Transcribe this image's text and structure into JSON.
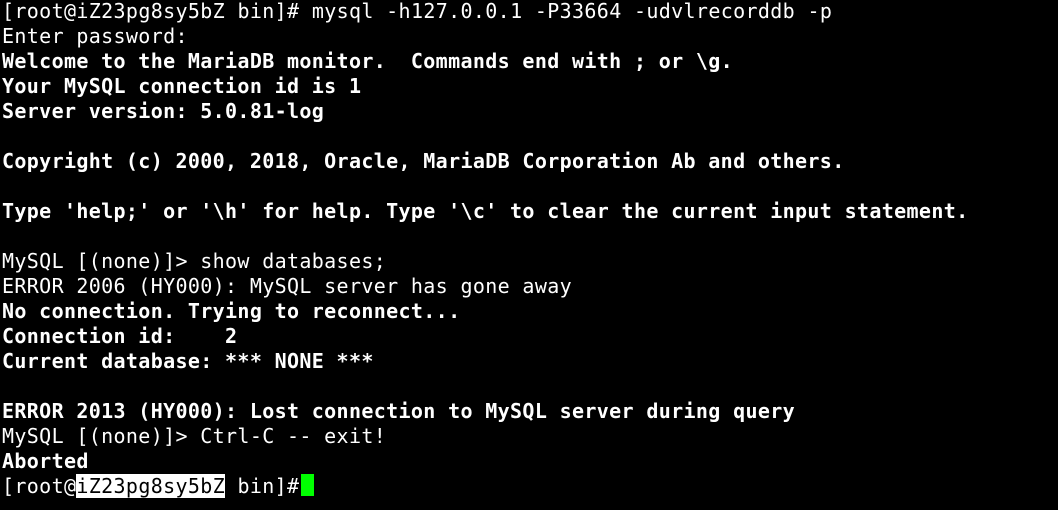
{
  "terminal": {
    "prompt_user_host_prefix": "[root@",
    "prompt_host": "iZ23pg8sy5bZ",
    "prompt_suffix": " bin]#",
    "command_1": " mysql -h127.0.0.1 -P33664 -udvlrecorddb -p",
    "line_enter_password": "Enter password:",
    "line_welcome": "Welcome to the MariaDB monitor.  Commands end with ; or \\g.",
    "line_connection_id": "Your MySQL connection id is 1",
    "line_server_version": "Server version: 5.0.81-log",
    "line_copyright": "Copyright (c) 2000, 2018, Oracle, MariaDB Corporation Ab and others.",
    "line_help": "Type 'help;' or '\\h' for help. Type '\\c' to clear the current input statement.",
    "line_show_databases": "MySQL [(none)]> show databases;",
    "line_error_2006": "ERROR 2006 (HY000): MySQL server has gone away",
    "line_no_connection": "No connection. Trying to reconnect...",
    "line_connection_id_2": "Connection id:    2",
    "line_current_db": "Current database: *** NONE ***",
    "line_error_2013": "ERROR 2013 (HY000): Lost connection to MySQL server during query",
    "line_ctrl_c": "MySQL [(none)]> Ctrl-C -- exit!",
    "line_aborted": "Aborted",
    "cursor_color": "#00ff00",
    "background_color": "#000000",
    "text_color": "#ffffff"
  }
}
